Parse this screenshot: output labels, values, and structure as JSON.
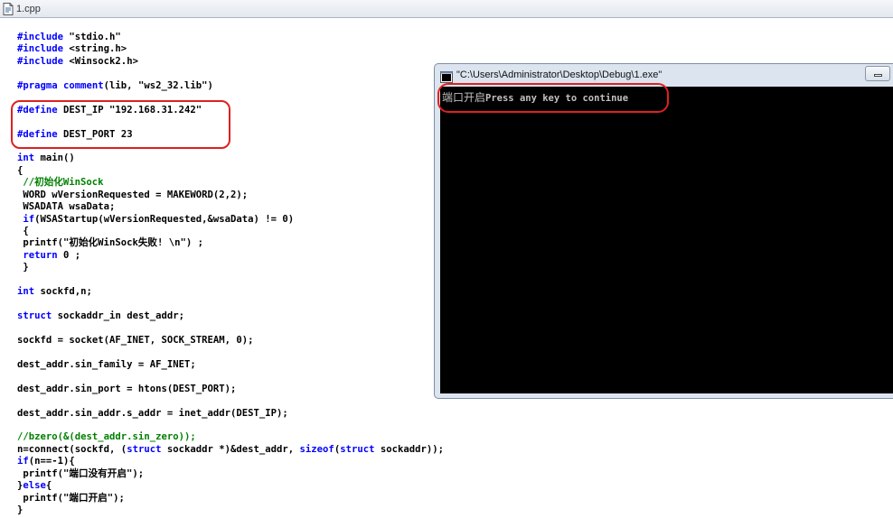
{
  "tab": {
    "filename": "1.cpp"
  },
  "code": [
    [
      {
        "t": "#include",
        "c": "kw"
      },
      {
        "t": " \"stdio.h\""
      }
    ],
    [
      {
        "t": "#include",
        "c": "kw"
      },
      {
        "t": " <string.h>"
      }
    ],
    [
      {
        "t": "#include",
        "c": "kw"
      },
      {
        "t": " <Winsock2.h>"
      }
    ],
    [],
    [
      {
        "t": "#pragma comment",
        "c": "kw"
      },
      {
        "t": "(lib, \"ws2_32.lib\")"
      }
    ],
    [],
    [
      {
        "t": "#define",
        "c": "kw"
      },
      {
        "t": " DEST_IP \"192.168.31.242\""
      }
    ],
    [],
    [
      {
        "t": "#define",
        "c": "kw"
      },
      {
        "t": " DEST_PORT 23"
      }
    ],
    [],
    [
      {
        "t": "int",
        "c": "kw"
      },
      {
        "t": " main()"
      }
    ],
    [
      {
        "t": "{"
      }
    ],
    [
      {
        "t": " //初始化WinSock",
        "c": "cm"
      }
    ],
    [
      {
        "t": " WORD wVersionRequested = MAKEWORD(2,2);"
      }
    ],
    [
      {
        "t": " WSADATA wsaData;"
      }
    ],
    [
      {
        "t": " "
      },
      {
        "t": "if",
        "c": "kw"
      },
      {
        "t": "(WSAStartup(wVersionRequested,&wsaData) != 0)"
      }
    ],
    [
      {
        "t": " {"
      }
    ],
    [
      {
        "t": " printf(\"初始化WinSock失败! \\n\") ;"
      }
    ],
    [
      {
        "t": " "
      },
      {
        "t": "return",
        "c": "kw"
      },
      {
        "t": " 0 ;"
      }
    ],
    [
      {
        "t": " }"
      }
    ],
    [],
    [
      {
        "t": "int",
        "c": "kw"
      },
      {
        "t": " sockfd,n;"
      }
    ],
    [],
    [
      {
        "t": "struct",
        "c": "kw"
      },
      {
        "t": " sockaddr_in dest_addr;"
      }
    ],
    [],
    [
      {
        "t": "sockfd = socket(AF_INET, SOCK_STREAM, 0);"
      }
    ],
    [],
    [
      {
        "t": "dest_addr.sin_family = AF_INET;"
      }
    ],
    [],
    [
      {
        "t": "dest_addr.sin_port = htons(DEST_PORT);"
      }
    ],
    [],
    [
      {
        "t": "dest_addr.sin_addr.s_addr = inet_addr(DEST_IP);"
      }
    ],
    [],
    [
      {
        "t": "//bzero(&(dest_addr.sin_zero));",
        "c": "cm"
      }
    ],
    [
      {
        "t": "n=connect(sockfd, ("
      },
      {
        "t": "struct",
        "c": "kw"
      },
      {
        "t": " sockaddr *)&dest_addr, "
      },
      {
        "t": "sizeof",
        "c": "kw"
      },
      {
        "t": "("
      },
      {
        "t": "struct",
        "c": "kw"
      },
      {
        "t": " sockaddr));"
      }
    ],
    [
      {
        "t": "if",
        "c": "kw"
      },
      {
        "t": "(n==-1){"
      }
    ],
    [
      {
        "t": " printf(\"端口没有开启\");"
      }
    ],
    [
      {
        "t": "}"
      },
      {
        "t": "else",
        "c": "kw"
      },
      {
        "t": "{"
      }
    ],
    [
      {
        "t": " printf(\"端口开启\");"
      }
    ],
    [
      {
        "t": "}"
      }
    ]
  ],
  "console": {
    "title": "\"C:\\Users\\Administrator\\Desktop\\Debug\\1.exe\"",
    "output_cn": "端口开启",
    "output_en": "Press any key to continue"
  },
  "colors": {
    "keyword": "#0000ff",
    "comment": "#008000",
    "annotation": "#e02020",
    "console_bg": "#000000"
  }
}
